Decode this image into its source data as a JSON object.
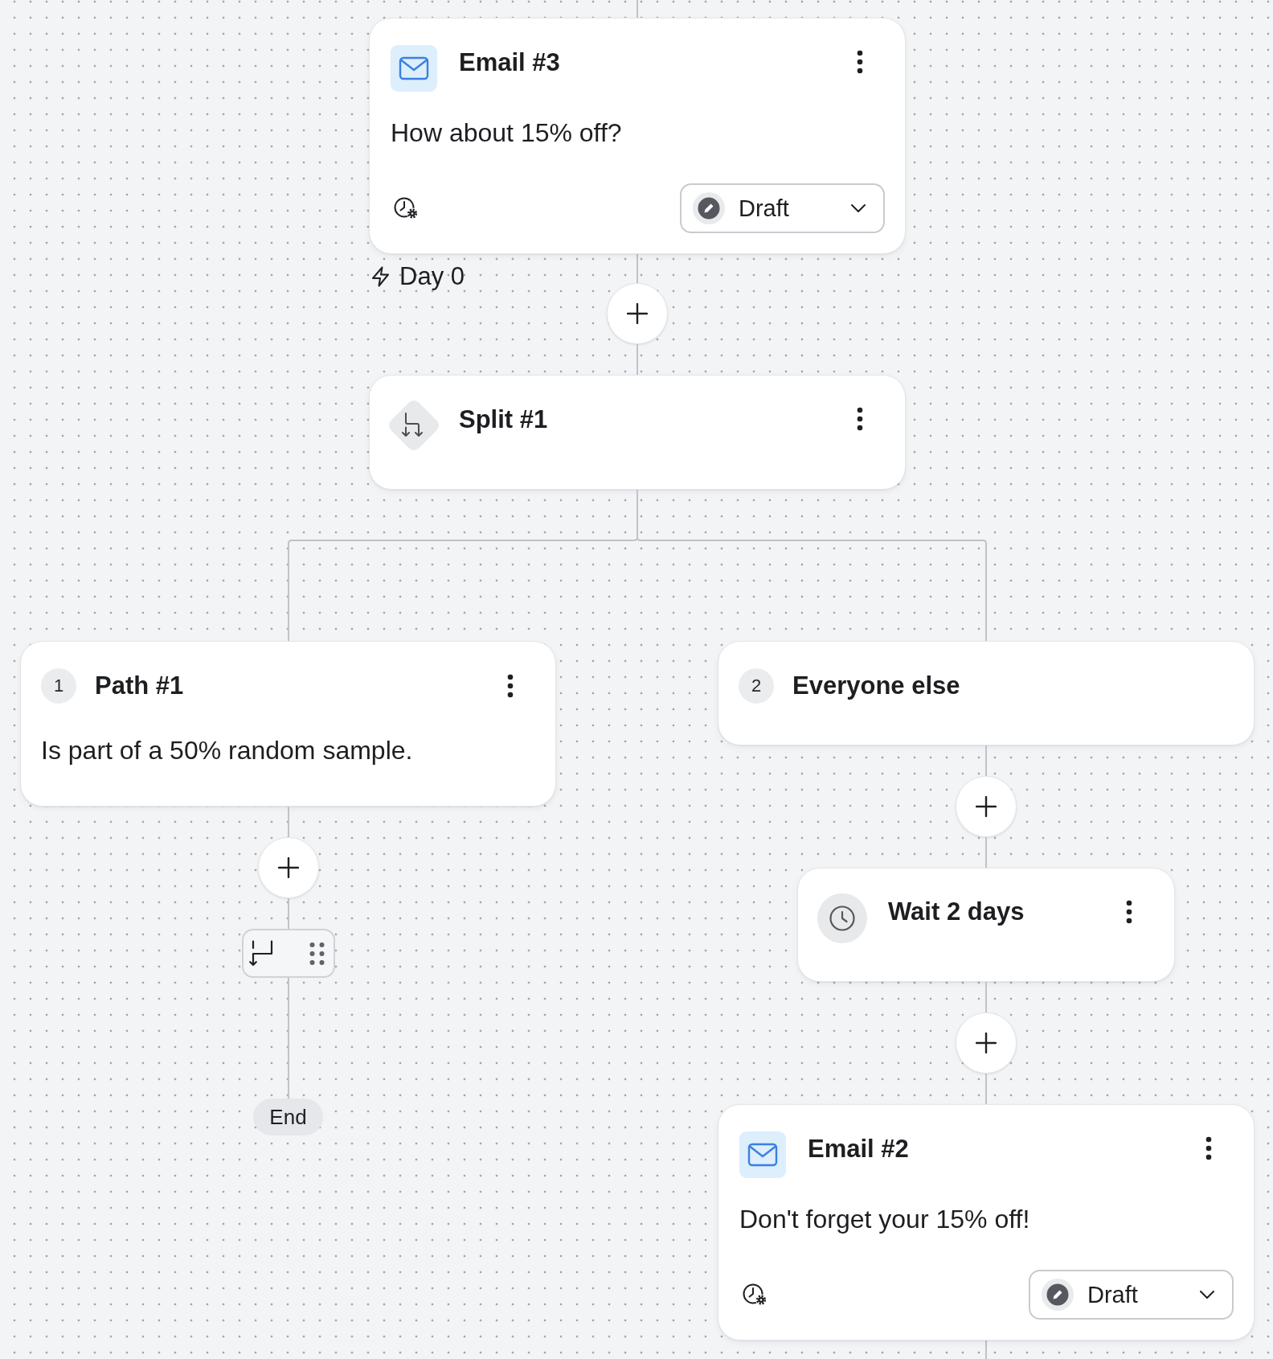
{
  "flow": {
    "steps": [
      {
        "kind": "email",
        "title": "Email #3",
        "subject": "How about 15% off?",
        "status": "Draft",
        "timing": "Day 0"
      },
      {
        "kind": "add"
      },
      {
        "kind": "split",
        "title": "Split #1"
      }
    ],
    "branches": [
      {
        "number": "1",
        "title": "Path #1",
        "menu": true,
        "condition": "Is part of a 50% random sample.",
        "steps": [
          {
            "kind": "add"
          },
          {
            "kind": "toolbar"
          },
          {
            "kind": "end",
            "label": "End"
          }
        ]
      },
      {
        "number": "2",
        "title": "Everyone else",
        "menu": false,
        "steps": [
          {
            "kind": "add"
          },
          {
            "kind": "wait",
            "title": "Wait 2 days"
          },
          {
            "kind": "add"
          },
          {
            "kind": "email",
            "title": "Email #2",
            "subject": "Don't forget your 15% off!",
            "status": "Draft"
          }
        ]
      }
    ]
  }
}
